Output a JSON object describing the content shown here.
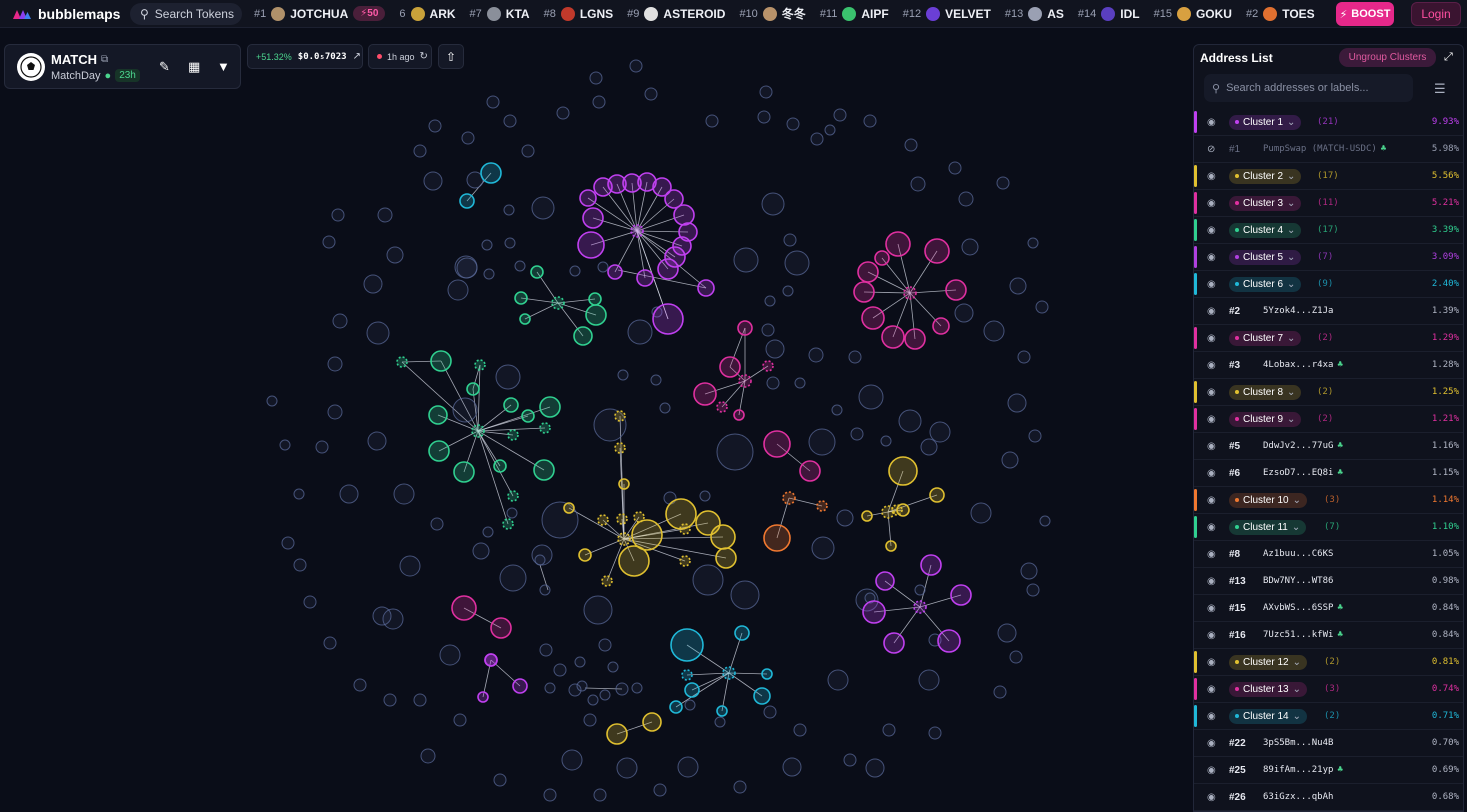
{
  "app": {
    "name": "bubblemaps"
  },
  "search": {
    "label": "Search Tokens"
  },
  "ticker": [
    {
      "rank": "#1",
      "name": "JOTCHUA",
      "color": "#b0916a"
    },
    {
      "rank": "6",
      "name": "ARK",
      "color": "#c9a23a"
    },
    {
      "rank": "#7",
      "name": "KTA",
      "color": "#8a8f9a"
    },
    {
      "rank": "#8",
      "name": "LGNS",
      "color": "#c0392b"
    },
    {
      "rank": "#9",
      "name": "ASTEROID",
      "color": "#e0e0e0"
    },
    {
      "rank": "#10",
      "name": "冬冬",
      "color": "#b8926a"
    },
    {
      "rank": "#11",
      "name": "AIPF",
      "color": "#3ac26e"
    },
    {
      "rank": "#12",
      "name": "VELVET",
      "color": "#6b3fd6"
    },
    {
      "rank": "#13",
      "name": "AS",
      "color": "#9aa0b3"
    },
    {
      "rank": "#14",
      "name": "IDL",
      "color": "#5a3fc0"
    },
    {
      "rank": "#15",
      "name": "GOKU",
      "color": "#d8a040"
    },
    {
      "rank": "#2",
      "name": "TOES",
      "color": "#e07030"
    }
  ],
  "ticker_boost": "50",
  "header": {
    "boost_label": "BOOST",
    "login_label": "Login"
  },
  "token": {
    "name": "MATCH",
    "subtitle": "MatchDay",
    "age": "23h",
    "price_change": "+51.32%",
    "price": "$0.0₅7023",
    "updated": "1h ago"
  },
  "panel": {
    "title": "Address List",
    "ungroup_label": "Ungroup Clusters",
    "search_placeholder": "Search addresses or labels..."
  },
  "rows": [
    {
      "kind": "cluster",
      "label": "Cluster 1",
      "count": "(21)",
      "pct": "9.93%",
      "color": "#c040f0"
    },
    {
      "kind": "addr",
      "rank": "#1",
      "addr": "PumpSwap (MATCH-USDC)",
      "pct": "5.98%",
      "hidden": true,
      "sprout": true
    },
    {
      "kind": "cluster",
      "label": "Cluster 2",
      "count": "(17)",
      "pct": "5.56%",
      "color": "#e0c030"
    },
    {
      "kind": "cluster",
      "label": "Cluster 3",
      "count": "(11)",
      "pct": "5.21%",
      "color": "#e030a0"
    },
    {
      "kind": "cluster",
      "label": "Cluster 4",
      "count": "(17)",
      "pct": "3.39%",
      "color": "#30d090"
    },
    {
      "kind": "cluster",
      "label": "Cluster 5",
      "count": "(7)",
      "pct": "3.09%",
      "color": "#b040e0"
    },
    {
      "kind": "cluster",
      "label": "Cluster 6",
      "count": "(9)",
      "pct": "2.40%",
      "color": "#20b8d8"
    },
    {
      "kind": "addr",
      "rank": "#2",
      "addr": "5Yzok4...Z1Ja",
      "pct": "1.39%"
    },
    {
      "kind": "cluster",
      "label": "Cluster 7",
      "count": "(2)",
      "pct": "1.29%",
      "color": "#e030a0"
    },
    {
      "kind": "addr",
      "rank": "#3",
      "addr": "4Lobax...r4xa",
      "pct": "1.28%",
      "sprout": true
    },
    {
      "kind": "cluster",
      "label": "Cluster 8",
      "count": "(2)",
      "pct": "1.25%",
      "color": "#e0c030"
    },
    {
      "kind": "cluster",
      "label": "Cluster 9",
      "count": "(2)",
      "pct": "1.21%",
      "color": "#e030a0"
    },
    {
      "kind": "addr",
      "rank": "#5",
      "addr": "DdwJv2...77uG",
      "pct": "1.16%",
      "sprout": true
    },
    {
      "kind": "addr",
      "rank": "#6",
      "addr": "EzsoD7...EQ8i",
      "pct": "1.15%",
      "sprout": true
    },
    {
      "kind": "cluster",
      "label": "Cluster 10",
      "count": "(3)",
      "pct": "1.14%",
      "color": "#f07830"
    },
    {
      "kind": "cluster",
      "label": "Cluster 11",
      "count": "(7)",
      "pct": "1.10%",
      "color": "#30d090"
    },
    {
      "kind": "addr",
      "rank": "#8",
      "addr": "Az1buu...C6KS",
      "pct": "1.05%"
    },
    {
      "kind": "addr",
      "rank": "#13",
      "addr": "BDw7NY...WT86",
      "pct": "0.98%"
    },
    {
      "kind": "addr",
      "rank": "#15",
      "addr": "AXvbWS...6SSP",
      "pct": "0.84%",
      "sprout": true
    },
    {
      "kind": "addr",
      "rank": "#16",
      "addr": "7Uzc51...kfWi",
      "pct": "0.84%",
      "sprout": true
    },
    {
      "kind": "cluster",
      "label": "Cluster 12",
      "count": "(2)",
      "pct": "0.81%",
      "color": "#e0c030"
    },
    {
      "kind": "cluster",
      "label": "Cluster 13",
      "count": "(3)",
      "pct": "0.74%",
      "color": "#e030a0"
    },
    {
      "kind": "cluster",
      "label": "Cluster 14",
      "count": "(2)",
      "pct": "0.71%",
      "color": "#20b8d8"
    },
    {
      "kind": "addr",
      "rank": "#22",
      "addr": "3pS5Bm...Nu4B",
      "pct": "0.70%"
    },
    {
      "kind": "addr",
      "rank": "#25",
      "addr": "89ifAm...21yp",
      "pct": "0.69%",
      "sprout": true
    },
    {
      "kind": "addr",
      "rank": "#26",
      "addr": "63iGzx...qbAh",
      "pct": "0.68%"
    }
  ],
  "graph_colors": {
    "cluster1": "#c040f0",
    "cluster2": "#e0c030",
    "cluster3": "#e030a0",
    "cluster4": "#30d090",
    "cluster6": "#20b8d8",
    "cluster10": "#f07830",
    "neutral": "#5a6a9a"
  }
}
